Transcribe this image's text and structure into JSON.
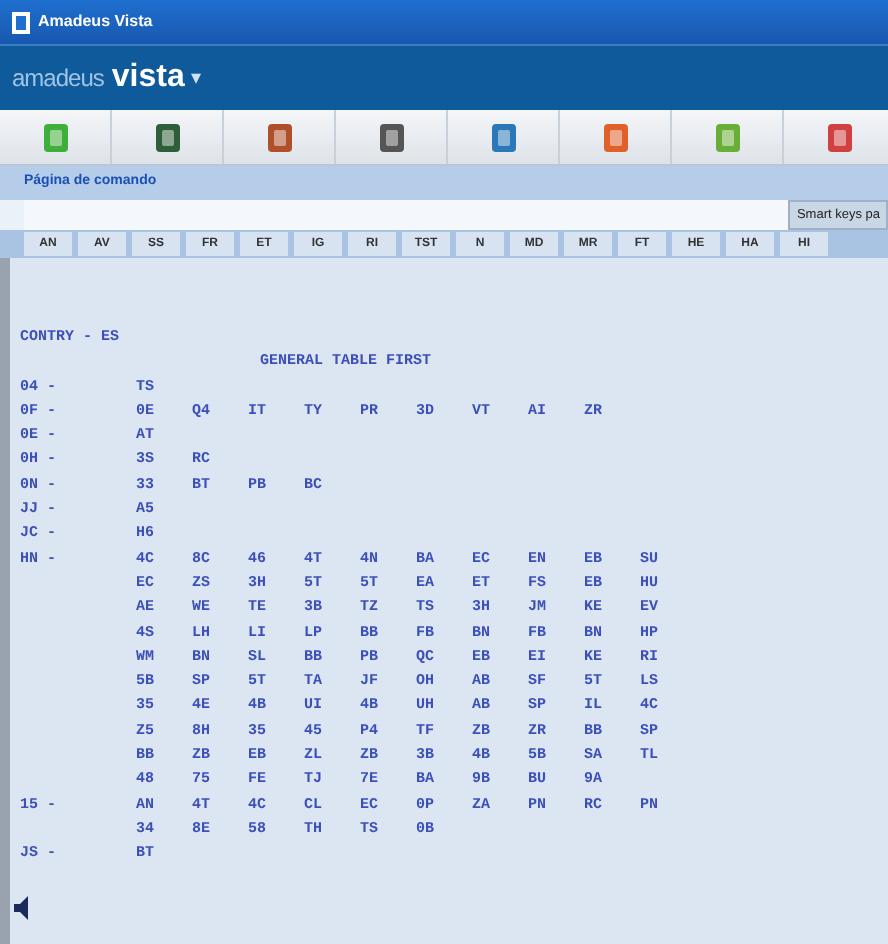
{
  "window": {
    "title": "Amadeus Vista"
  },
  "brand": {
    "prefix": "amadeus",
    "name": "vista",
    "caret": "▾"
  },
  "toolbar": [
    {
      "color": "#3fae3a"
    },
    {
      "color": "#2f5f3a"
    },
    {
      "color": "#b0502a"
    },
    {
      "color": "#555555"
    },
    {
      "color": "#2a78b8"
    },
    {
      "color": "#e0602a"
    },
    {
      "color": "#6aae3a"
    },
    {
      "color": "#d04040"
    }
  ],
  "command_bar": {
    "label": "Página de comando",
    "smart_keys": "Smart keys pa"
  },
  "function_keys": [
    "AN",
    "AV",
    "SS",
    "FR",
    "ET",
    "IG",
    "RI",
    "TST",
    "N",
    "MD",
    "MR",
    "FT",
    "HE",
    "HA",
    "HI"
  ],
  "terminal": {
    "header": "CONTRY - ES",
    "title": "GENERAL TABLE FIRST",
    "lines": [
      {
        "prefix": "04 -",
        "codes": [
          "TS"
        ]
      },
      {
        "prefix": "0F -",
        "codes": [
          "0E",
          "Q4",
          "IT",
          "TY",
          "PR",
          "3D",
          "VT",
          "AI",
          "ZR"
        ]
      },
      {
        "prefix": "0E -",
        "codes": [
          "AT"
        ]
      },
      {
        "prefix": "0H -",
        "codes": [
          "3S",
          "RC"
        ]
      },
      {
        "prefix": "0N -",
        "codes": [
          "33",
          "BT",
          "PB",
          "BC"
        ]
      },
      {
        "prefix": "JJ -",
        "codes": [
          "A5"
        ]
      },
      {
        "prefix": "JC -",
        "codes": [
          "H6"
        ]
      },
      {
        "prefix": "HN -",
        "codes": [
          "4C",
          "8C",
          "46",
          "4T",
          "4N",
          "BA",
          "EC",
          "EN",
          "EB",
          "SU"
        ]
      },
      {
        "codes": [
          "EC",
          "ZS",
          "3H",
          "5T",
          "5T",
          "EA",
          "ET",
          "FS",
          "EB",
          "HU"
        ]
      },
      {
        "codes": [
          "AE",
          "WE",
          "TE",
          "3B",
          "TZ",
          "TS",
          "3H",
          "JM",
          "KE",
          "EV"
        ]
      },
      {
        "codes": [
          "4S",
          "LH",
          "LI",
          "LP",
          "BB",
          "FB",
          "BN",
          "FB",
          "BN",
          "HP"
        ]
      },
      {
        "codes": [
          "WM",
          "BN",
          "SL",
          "BB",
          "PB",
          "QC",
          "EB",
          "EI",
          "KE",
          "RI"
        ]
      },
      {
        "codes": [
          "5B",
          "SP",
          "5T",
          "TA",
          "JF",
          "OH",
          "AB",
          "SF",
          "5T",
          "LS"
        ]
      },
      {
        "codes": [
          "35",
          "4E",
          "4B",
          "UI",
          "4B",
          "UH",
          "AB",
          "SP",
          "IL",
          "4C"
        ]
      },
      {
        "codes": [
          "Z5",
          "8H",
          "35",
          "45",
          "P4",
          "TF",
          "ZB",
          "ZR",
          "BB",
          "SP"
        ]
      },
      {
        "codes": [
          "BB",
          "ZB",
          "EB",
          "ZL",
          "ZB",
          "3B",
          "4B",
          "5B",
          "SA",
          "TL"
        ]
      },
      {
        "codes": [
          "48",
          "75",
          "FE",
          "TJ",
          "7E",
          "BA",
          "9B",
          "BU",
          "9A"
        ]
      },
      {
        "prefix": "15 -",
        "codes": [
          "AN",
          "4T",
          "4C",
          "CL",
          "EC",
          "0P",
          "ZA",
          "PN",
          "RC",
          "PN"
        ]
      },
      {
        "codes": [
          "34",
          "8E",
          "58",
          "TH",
          "TS",
          "0B"
        ]
      },
      {
        "prefix": "JS -",
        "codes": [
          "BT"
        ]
      }
    ]
  }
}
